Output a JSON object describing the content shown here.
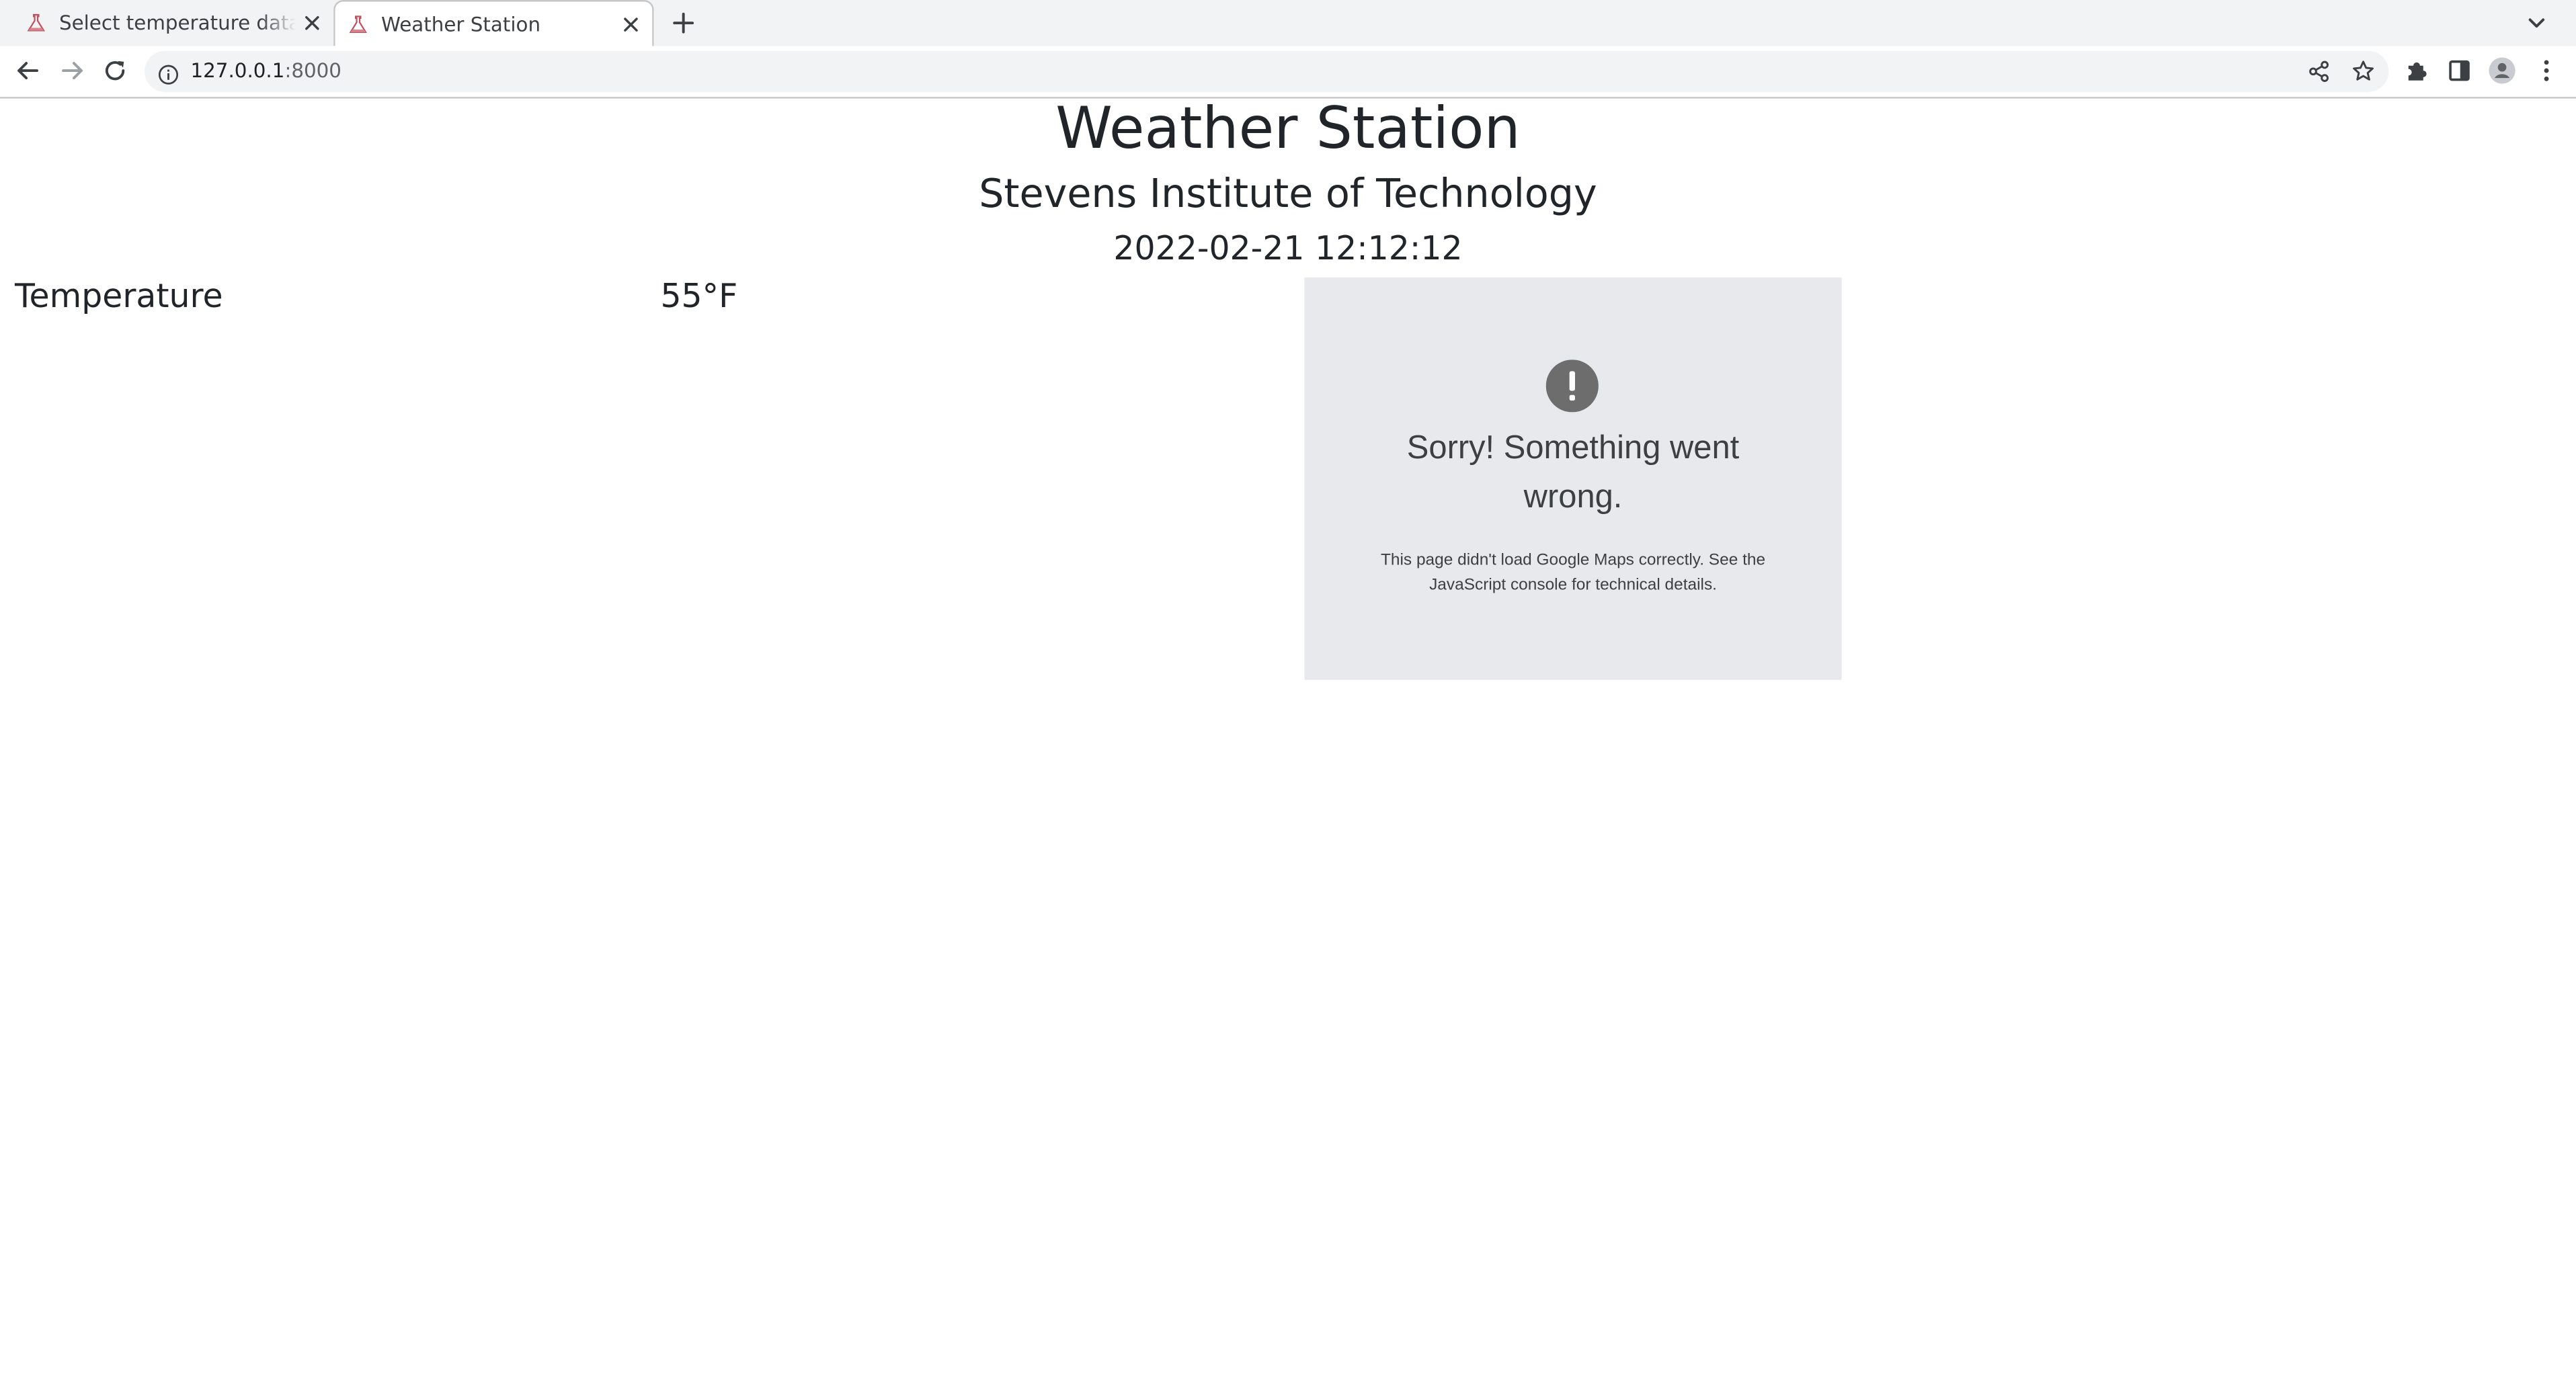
{
  "browser": {
    "tabs": [
      {
        "title": "Select temperature data to",
        "active": false
      },
      {
        "title": "Weather Station",
        "active": true
      }
    ],
    "address": {
      "host": "127.0.0.1",
      "port": ":8000"
    },
    "icons": {
      "favicon": "flask-favicon-icon",
      "tab_close": "close-icon",
      "new_tab": "plus-icon",
      "tab_search": "chevron-down-icon",
      "back": "arrow-left-icon",
      "forward": "arrow-right-icon",
      "reload": "reload-icon",
      "site_info": "info-icon",
      "share": "share-icon",
      "bookmark": "star-icon",
      "extensions": "puzzle-icon",
      "side_panel": "side-panel-icon",
      "profile": "profile-icon",
      "menu": "kebab-menu-icon"
    }
  },
  "page": {
    "title": "Weather Station",
    "subtitle": "Stevens Institute of Technology",
    "datetime": "2022-02-21 12:12:12",
    "reading": {
      "label": "Temperature",
      "value": "55°F"
    },
    "map_error": {
      "icon": "alert-icon",
      "heading": "Sorry! Something went wrong.",
      "detail": "This page didn't load Google Maps correctly. See the JavaScript console for technical details."
    }
  },
  "colors": {
    "tabstrip_bg": "#f1f3f4",
    "omnibox_bg": "#f1f3f4",
    "text": "#212529",
    "map_error_bg": "#e8e9ed",
    "map_error_icon": "#6d6d6d"
  }
}
